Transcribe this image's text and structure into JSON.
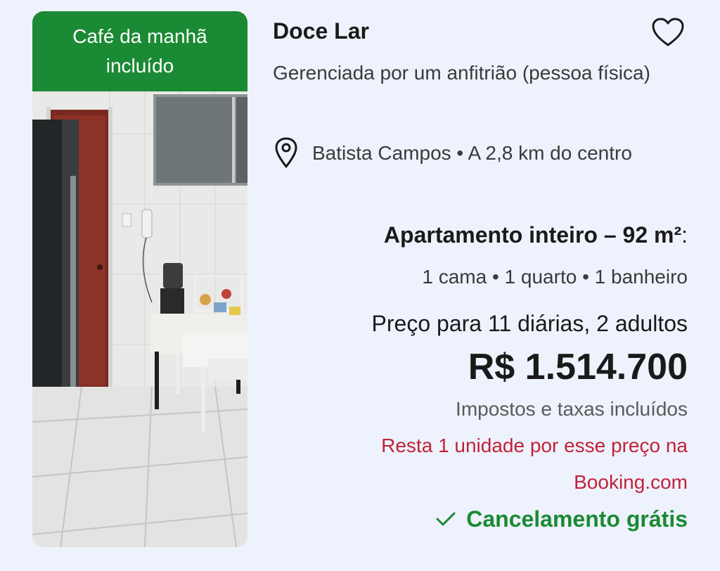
{
  "listing": {
    "badge_line1": "Café da manhã",
    "badge_line2": "incluído",
    "photo_icon": "room-photo",
    "title": "Doce Lar",
    "favorite_icon": "heart-outline-icon",
    "managed_by": "Gerenciada por um anfitrião (pessoa física)",
    "location_icon": "map-pin-icon",
    "location": "Batista Campos • A 2,8 km do centro",
    "unit_type": "Apartamento inteiro – 92 m²",
    "unit_type_suffix": ":",
    "unit_details": "1 cama • 1 quarto • 1 banheiro",
    "price_label": "Preço para 11 diárias, 2 adultos",
    "price": "R$ 1.514.700",
    "taxes_note": "Impostos e taxas incluídos",
    "scarcity": "Resta 1 unidade por esse preço na Booking.com",
    "cancellation_icon": "check-icon",
    "cancellation": "Cancelamento grátis"
  },
  "colors": {
    "badge_bg": "#1b8a34",
    "cancellation": "#1b8a34",
    "scarcity": "#c0233a",
    "page_bg": "#eef2fc"
  }
}
